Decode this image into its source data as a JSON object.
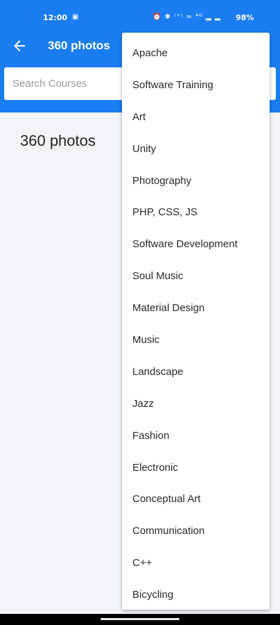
{
  "status_bar": {
    "time": "12:00",
    "left_icon": "▣",
    "sys_icons": "⏰ ✱ ⁽⁺⁾ ≈ ⁴ᴳ ▂ ▂",
    "battery": "98%"
  },
  "app_bar": {
    "title": "360 photos",
    "accent_color": "#1a7df2"
  },
  "search": {
    "placeholder": "Search Courses",
    "value": ""
  },
  "main": {
    "heading": "360 photos"
  },
  "dropdown": {
    "items": [
      "Apache",
      "Software Training",
      "Art",
      "Unity",
      "Photography",
      "PHP, CSS, JS",
      "Software Development",
      "Soul Music",
      "Material Design",
      "Music",
      "Landscape",
      "Jazz",
      "Fashion",
      "Electronic",
      "Conceptual Art",
      "Communication",
      "C++",
      "Bicycling"
    ]
  }
}
